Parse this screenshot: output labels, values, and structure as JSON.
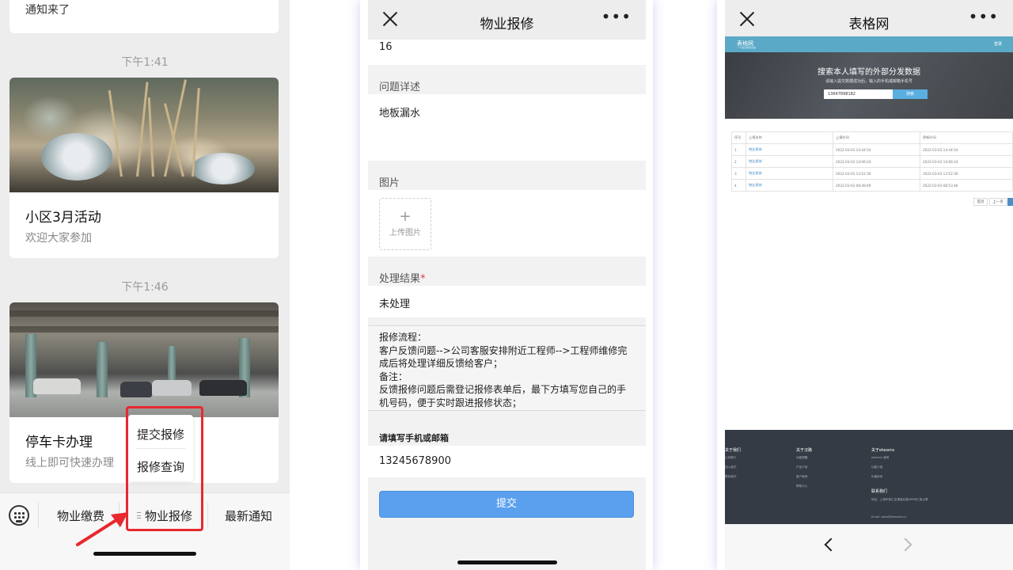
{
  "chat": {
    "partial_card_text": "通知来了",
    "timestamps": [
      "下午1:41",
      "下午1:46"
    ],
    "cards": [
      {
        "title": "小区3月活动",
        "subtitle": "欢迎大家参加",
        "image": "dining-table-photo"
      },
      {
        "title": "停车卡办理",
        "subtitle": "线上即可快速办理",
        "image": "parking-garage-photo"
      }
    ],
    "popup_menu": [
      "提交报修",
      "报修查询"
    ],
    "tabbar": {
      "keyboard_icon": "keyboard-icon",
      "tabs": [
        "物业缴费",
        "物业报修",
        "最新通知"
      ]
    },
    "highlight_color": "#e8282e"
  },
  "form": {
    "nav_title": "物业报修",
    "top_value": "16",
    "issue_label": "问题详述",
    "issue_value": "地板漏水",
    "image_label": "图片",
    "upload_label": "上传图片",
    "result_label": "处理结果",
    "result_required_mark": "*",
    "result_value": "未处理",
    "notice_lines": [
      "报修流程：",
      "客户反馈问题-->公司客服安排附近工程师-->工程师维修完成后将处理详细反馈给客户；",
      "备注：",
      "反馈报修问题后需登记报修表单后，最下方填写您自己的手机号码，便于实时跟进报修状态；"
    ],
    "contact_label": "请填写手机或邮箱",
    "contact_value": "13245678900",
    "submit_label": "提交",
    "accent_color": "#5aa0ee"
  },
  "web": {
    "nav_title": "表格网",
    "site_logo": "表格网",
    "site_logo_sub": "一个站点搜索表格",
    "login_label": "登录",
    "hero_title": "搜索本人填写的外部分发数据",
    "hero_subtitle": "请输入提交数据成功后，输入的手机或邮箱手机号",
    "search_value": "13647898182",
    "search_button": "搜索",
    "table": {
      "headers": [
        "序号",
        "上报名称",
        "上报时间",
        "更新时间"
      ],
      "rows": [
        [
          "1",
          "物业报修",
          "2022-03-03 14:44:54",
          "2022-03-03 14:44:54"
        ],
        [
          "2",
          "物业报修",
          "2022-03-03 14:06:24",
          "2022-03-03 14:06:24"
        ],
        [
          "3",
          "物业报修",
          "2022-03-03 13:52:30",
          "2022-03-03 13:52:30"
        ],
        [
          "4",
          "物业报修",
          "2022-03-03 08:49:49",
          "2022-03-03 08:53:46"
        ]
      ]
    },
    "pager": [
      "首页",
      "上一页"
    ],
    "footer": {
      "col1_title": "关于我们",
      "col1_items": [
        "公司简介",
        "加入我们",
        "联系我们"
      ],
      "col2_title": "关于汉路",
      "col2_items": [
        "功能提醒",
        "产品介绍",
        "客户案例",
        "帮助中心"
      ],
      "col3_title": "关于ekeams",
      "col3_items": [
        "ekeams 官网",
        "功能介绍",
        "价格体系"
      ],
      "contact_title": "联系我们",
      "contact_lines": [
        "地址：上海市徐汇区漕溪北路398号汇智大厦",
        "Email: sales@ekeams.cn"
      ]
    }
  }
}
